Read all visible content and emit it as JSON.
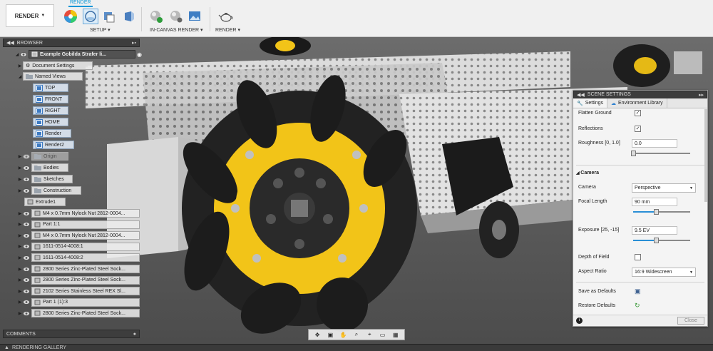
{
  "toolbar": {
    "workspace_label": "RENDER",
    "active_tab": "RENDER",
    "groups": {
      "setup": "SETUP",
      "in_canvas": "IN-CANVAS RENDER",
      "render": "RENDER"
    }
  },
  "browser": {
    "title": "BROWSER",
    "document_name": "Example Gobilda Strafer li...",
    "items": {
      "document_settings": "Document Settings",
      "named_views": "Named Views",
      "view_top": "TOP",
      "view_front": "FRONT",
      "view_right": "RIGHT",
      "view_home": "HOME",
      "view_render": "Render",
      "view_render2": "Render2",
      "origin": "Origin",
      "bodies": "Bodies",
      "sketches": "Sketches",
      "construction": "Construction",
      "extrude1": "Extrude1"
    },
    "components": [
      "M4 x 0.7mm Nylock Nut 2812-0004...",
      "Part 1:1",
      "M4 x 0.7mm Nylock Nut 2812-0004...",
      "1611-0514-4008:1",
      "1611-0514-4008:2",
      "2800 Series Zinc-Plated Steel Sock...",
      "2800 Series Zinc-Plated Steel Sock...",
      "2102 Series Stainless Steel REX Sl...",
      "Part 1 (1):3",
      "2800 Series Zinc-Plated Steel Sock..."
    ]
  },
  "comments_label": "COMMENTS",
  "gallery_label": "RENDERING GALLERY",
  "scene": {
    "title": "SCENE SETTINGS",
    "tabs": {
      "settings": "Settings",
      "environment": "Environment Library"
    },
    "flatten_ground": {
      "label": "Flatten Ground",
      "checked": true
    },
    "reflections": {
      "label": "Reflections",
      "checked": true
    },
    "roughness": {
      "label": "Roughness [0, 1.0]",
      "value": "0.0",
      "level": 0
    },
    "camera_section": "Camera",
    "camera": {
      "label": "Camera",
      "value": "Perspective"
    },
    "focal_length": {
      "label": "Focal Length",
      "value": "90 mm",
      "level": 0.4
    },
    "exposure": {
      "label": "Exposure [25, -15]",
      "value": "9.5 EV",
      "level": 0.4
    },
    "depth_of_field": {
      "label": "Depth of Field",
      "checked": false
    },
    "aspect_ratio": {
      "label": "Aspect Ratio",
      "value": "16:9 Widescreen"
    },
    "save_defaults": "Save as Defaults",
    "restore_defaults": "Restore Defaults",
    "close": "Close"
  },
  "colors": {
    "accent": "#0696d7",
    "wheel_yellow": "#f2c418",
    "roller_black": "#1c1c1c"
  }
}
